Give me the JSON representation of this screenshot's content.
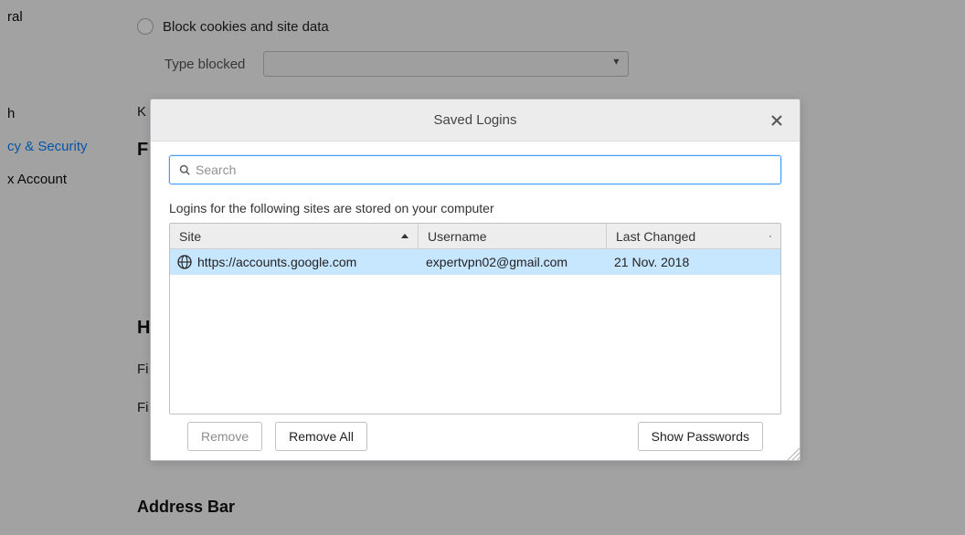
{
  "sidebar": {
    "items": [
      {
        "label": "ral"
      },
      {
        "label": "h"
      },
      {
        "label": "cy & Security"
      },
      {
        "label": "x Account"
      }
    ],
    "active_index": 2
  },
  "bg": {
    "block_cookies": "Block cookies and site data",
    "type_blocked": "Type blocked",
    "keep": "K",
    "forms_heading": "F",
    "history_heading": "Hi",
    "fi1": "Fi",
    "fi2": "Fi",
    "address_bar": "Address Bar"
  },
  "dialog": {
    "title": "Saved Logins",
    "search_placeholder": "Search",
    "description": "Logins for the following sites are stored on your computer",
    "columns": {
      "site": "Site",
      "username": "Username",
      "last_changed": "Last Changed"
    },
    "rows": [
      {
        "site": "https://accounts.google.com",
        "username": "expertvpn02@gmail.com",
        "last_changed": "21 Nov. 2018"
      }
    ],
    "buttons": {
      "remove": "Remove",
      "remove_all": "Remove All",
      "show_passwords": "Show Passwords"
    }
  }
}
